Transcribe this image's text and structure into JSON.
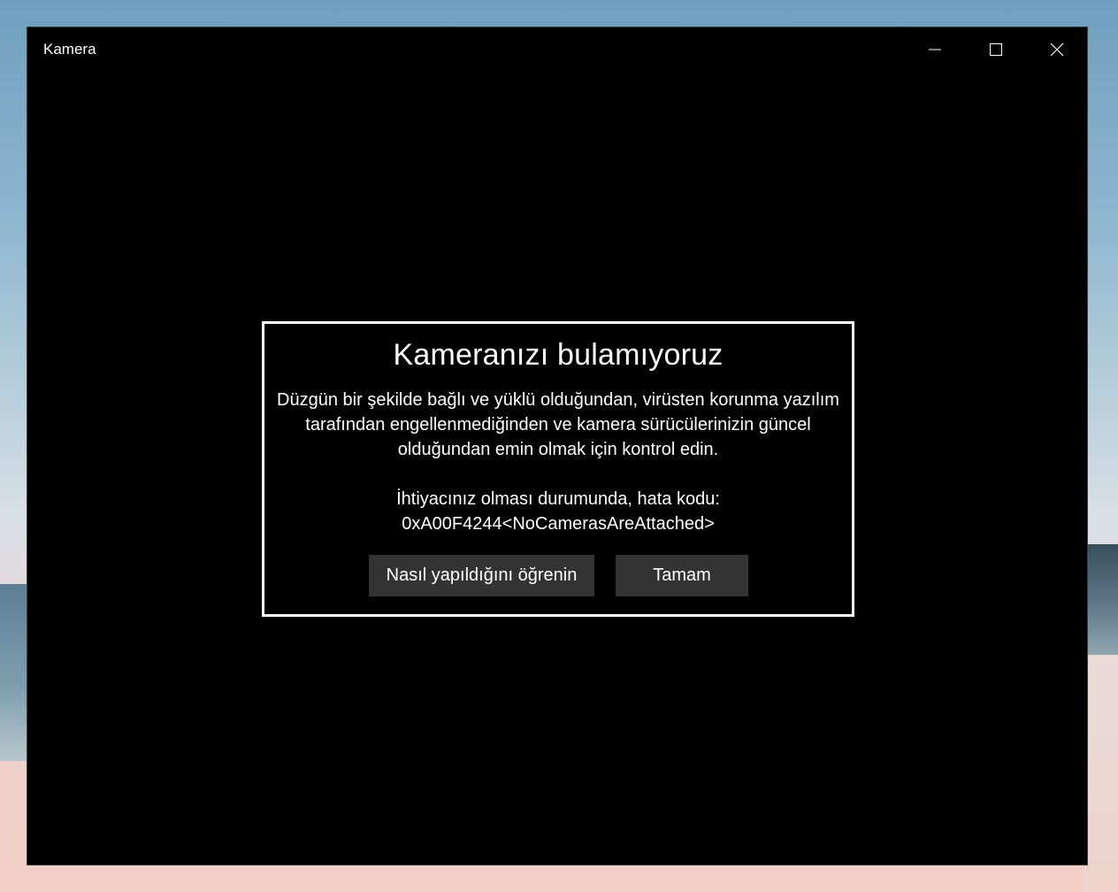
{
  "window": {
    "title": "Kamera",
    "controls": {
      "minimize": "minimize-icon",
      "maximize": "maximize-icon",
      "close": "close-icon"
    }
  },
  "dialog": {
    "title": "Kameranızı bulamıyoruz",
    "message_lines": [
      "Düzgün bir şekilde bağlı ve yüklü olduğundan, virüsten korunma yazılım",
      "tarafından engellenmediğinden ve kamera sürücülerinizin güncel",
      "olduğundan emin olmak için kontrol edin."
    ],
    "error_intro": "İhtiyacınız olması durumunda, hata kodu:",
    "error_code": "0xA00F4244<NoCamerasAreAttached>",
    "buttons": {
      "learn": "Nasıl yapıldığını öğrenin",
      "ok": "Tamam"
    }
  },
  "colors": {
    "window_bg": "#000000",
    "button_bg": "#333333",
    "text": "#ffffff"
  }
}
